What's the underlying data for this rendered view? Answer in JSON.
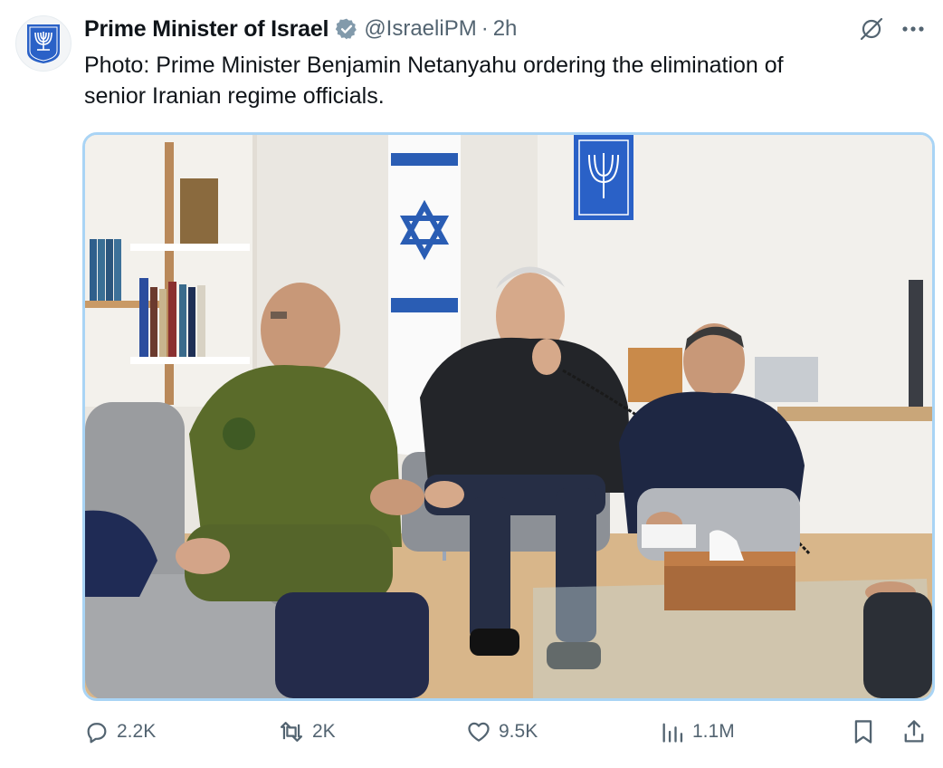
{
  "author": {
    "name": "Prime Minister of Israel",
    "handle": "@IsraeliPM",
    "separator": "·",
    "time": "2h",
    "avatar_icon": "menorah-emblem-icon",
    "verified_icon": "verified-badge-icon"
  },
  "tweet": {
    "text": "Photo: Prime Minister Benjamin Netanyahu ordering the elimination of\nsenior Iranian regime officials."
  },
  "header_actions": [
    "grok-icon",
    "more-icon"
  ],
  "stats": {
    "replies": "2.2K",
    "reposts": "2K",
    "likes": "9.5K",
    "views": "1.1M"
  },
  "colors": {
    "text": "#0f1419",
    "secondary": "#536471",
    "verified": "#829aab",
    "media_border": "#a9d4f5",
    "flag_blue": "#2a5db4"
  }
}
